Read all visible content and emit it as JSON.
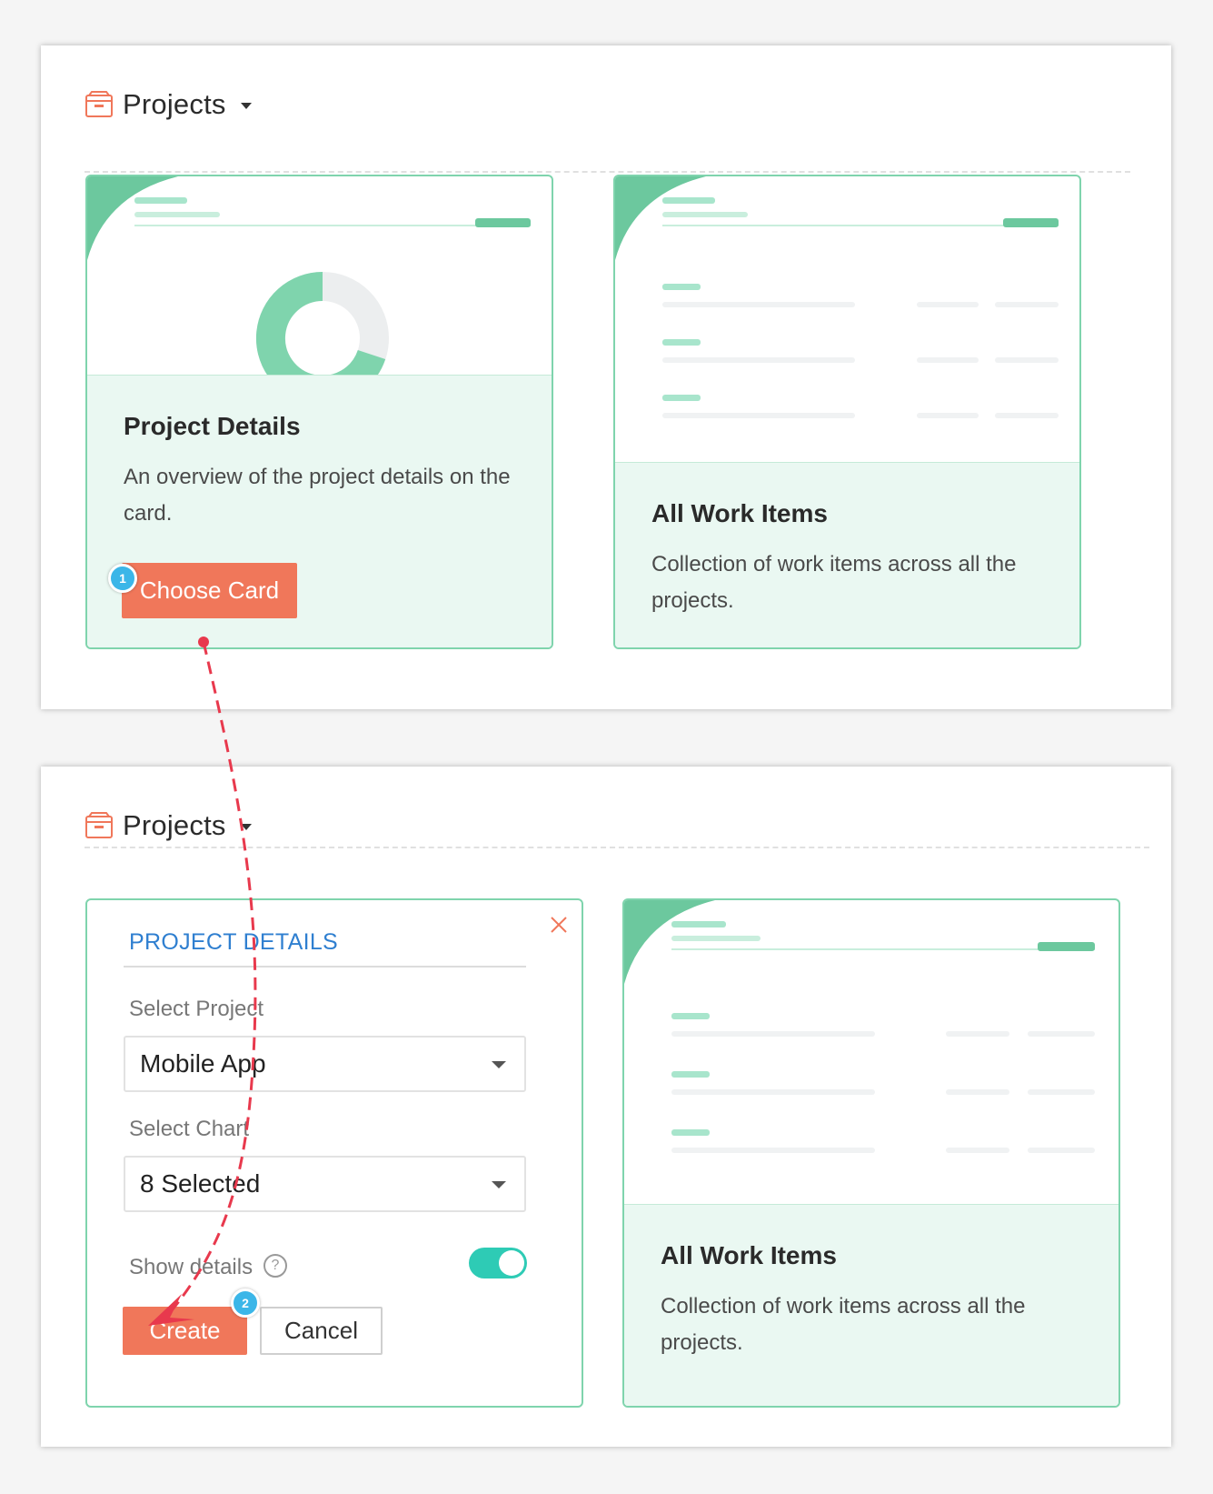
{
  "panel_top": {
    "title": "Projects",
    "card_details": {
      "title": "Project Details",
      "description": "An overview of the project details on the card.",
      "choose_button": "Choose Card",
      "step_badge": "1"
    },
    "card_workitems": {
      "title": "All Work Items",
      "description": "Collection of work items across all the projects."
    }
  },
  "panel_bottom": {
    "title": "Projects",
    "form": {
      "heading": "PROJECT DETAILS",
      "project_label": "Select Project",
      "project_value": "Mobile App",
      "chart_label": "Select Chart",
      "chart_value": "8 Selected",
      "show_details_label": "Show details",
      "show_details_on": true,
      "create_button": "Create",
      "cancel_button": "Cancel",
      "step_badge": "2"
    },
    "card_workitems": {
      "title": "All Work Items",
      "description": "Collection of work items across all the projects."
    }
  },
  "colors": {
    "accent_orange": "#f0775a",
    "card_border": "#7fd4ad",
    "heading_blue": "#2f7fd0",
    "toggle_on": "#2ecbb5",
    "badge_blue": "#3bb6e8",
    "arrow_red": "#e8394d"
  },
  "icons": [
    "box-icon",
    "chevron-down-icon",
    "close-icon",
    "help-circle-icon",
    "donut-chart-icon"
  ]
}
